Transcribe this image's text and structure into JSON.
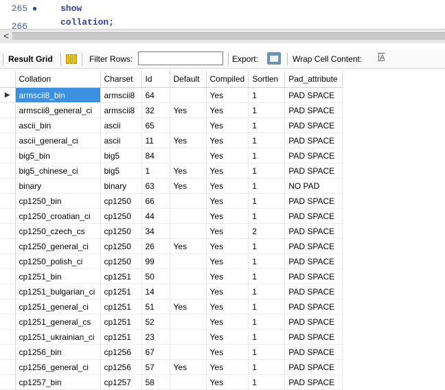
{
  "editor": {
    "lines": [
      {
        "num": "265",
        "marker": "●",
        "code": "show collation;"
      },
      {
        "num": "266",
        "marker": "",
        "code": ""
      }
    ]
  },
  "scrollbar": {
    "left_arrow": "<"
  },
  "toolbar": {
    "result_grid_label": "Result Grid",
    "filter_rows_label": "Filter Rows:",
    "filter_value": "",
    "export_label": "Export:",
    "wrap_label": "Wrap Cell Content:",
    "wrap_icon": "IA"
  },
  "grid": {
    "columns": [
      "Collation",
      "Charset",
      "Id",
      "Default",
      "Compiled",
      "Sortlen",
      "Pad_attribute"
    ],
    "selected_row_marker": "▶",
    "rows": [
      [
        "armscii8_bin",
        "armscii8",
        "64",
        "",
        "Yes",
        "1",
        "PAD SPACE"
      ],
      [
        "armscii8_general_ci",
        "armscii8",
        "32",
        "Yes",
        "Yes",
        "1",
        "PAD SPACE"
      ],
      [
        "ascii_bin",
        "ascii",
        "65",
        "",
        "Yes",
        "1",
        "PAD SPACE"
      ],
      [
        "ascii_general_ci",
        "ascii",
        "11",
        "Yes",
        "Yes",
        "1",
        "PAD SPACE"
      ],
      [
        "big5_bin",
        "big5",
        "84",
        "",
        "Yes",
        "1",
        "PAD SPACE"
      ],
      [
        "big5_chinese_ci",
        "big5",
        "1",
        "Yes",
        "Yes",
        "1",
        "PAD SPACE"
      ],
      [
        "binary",
        "binary",
        "63",
        "Yes",
        "Yes",
        "1",
        "NO PAD"
      ],
      [
        "cp1250_bin",
        "cp1250",
        "66",
        "",
        "Yes",
        "1",
        "PAD SPACE"
      ],
      [
        "cp1250_croatian_ci",
        "cp1250",
        "44",
        "",
        "Yes",
        "1",
        "PAD SPACE"
      ],
      [
        "cp1250_czech_cs",
        "cp1250",
        "34",
        "",
        "Yes",
        "2",
        "PAD SPACE"
      ],
      [
        "cp1250_general_ci",
        "cp1250",
        "26",
        "Yes",
        "Yes",
        "1",
        "PAD SPACE"
      ],
      [
        "cp1250_polish_ci",
        "cp1250",
        "99",
        "",
        "Yes",
        "1",
        "PAD SPACE"
      ],
      [
        "cp1251_bin",
        "cp1251",
        "50",
        "",
        "Yes",
        "1",
        "PAD SPACE"
      ],
      [
        "cp1251_bulgarian_ci",
        "cp1251",
        "14",
        "",
        "Yes",
        "1",
        "PAD SPACE"
      ],
      [
        "cp1251_general_ci",
        "cp1251",
        "51",
        "Yes",
        "Yes",
        "1",
        "PAD SPACE"
      ],
      [
        "cp1251_general_cs",
        "cp1251",
        "52",
        "",
        "Yes",
        "1",
        "PAD SPACE"
      ],
      [
        "cp1251_ukrainian_ci",
        "cp1251",
        "23",
        "",
        "Yes",
        "1",
        "PAD SPACE"
      ],
      [
        "cp1256_bin",
        "cp1256",
        "67",
        "",
        "Yes",
        "1",
        "PAD SPACE"
      ],
      [
        "cp1256_general_ci",
        "cp1256",
        "57",
        "Yes",
        "Yes",
        "1",
        "PAD SPACE"
      ],
      [
        "cp1257_bin",
        "cp1257",
        "58",
        "",
        "Yes",
        "1",
        "PAD SPACE"
      ]
    ]
  }
}
